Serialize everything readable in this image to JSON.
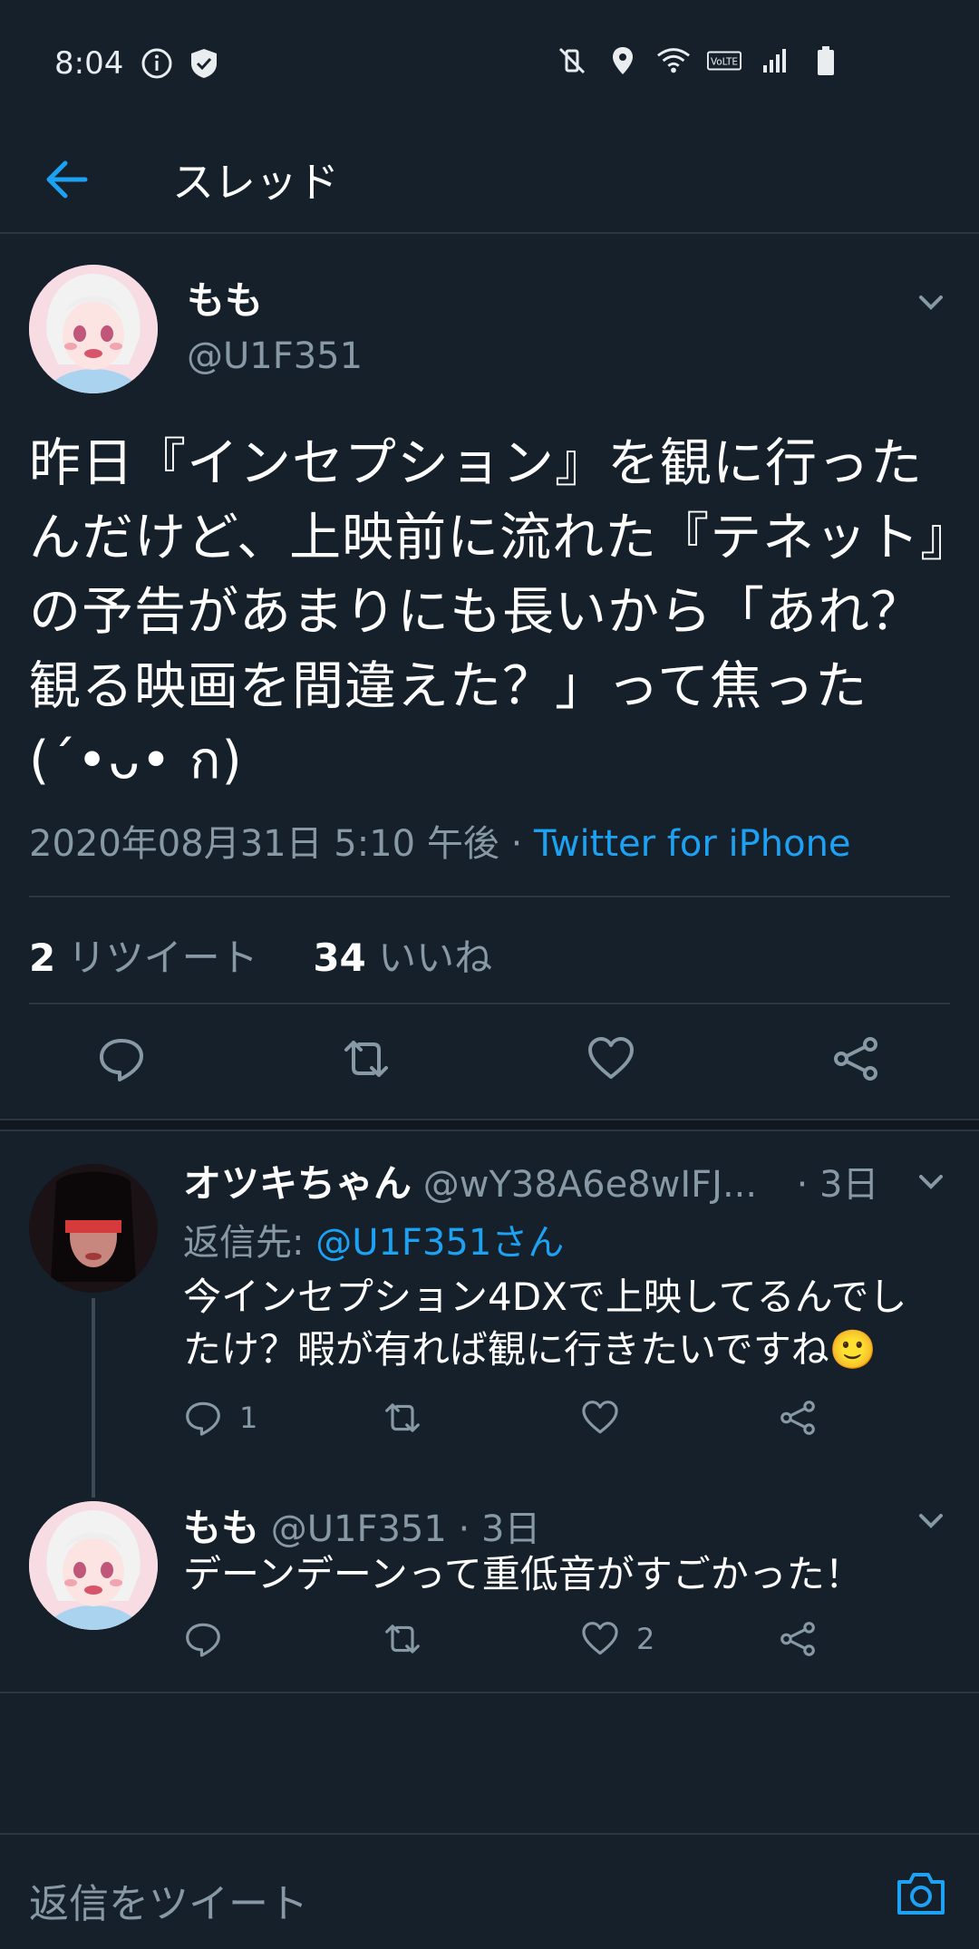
{
  "status_bar": {
    "time": "8:04",
    "icons_left": [
      "info-icon",
      "shield-icon"
    ],
    "icons_right": [
      "mute-vibrate-icon",
      "location-icon",
      "wifi-icon",
      "volte-icon",
      "signal-icon",
      "battery-icon"
    ]
  },
  "header": {
    "title": "スレッド",
    "back_icon": "arrow-left-icon"
  },
  "main_tweet": {
    "name": "もも",
    "handle": "@U1F351",
    "text": "昨日『インセプション』を観に行ったんだけど、上映前に流れた『テネット』の予告があまりにも長いから「あれ？観る映画を間違えた？」って焦った(´•ᴗ• ก)",
    "timestamp": "2020年08月31日 5:10 午後",
    "separator": "·",
    "source": "Twitter for iPhone",
    "retweet_count": "2",
    "retweet_label": "リツイート",
    "like_count": "34",
    "like_label": "いいね"
  },
  "replies": [
    {
      "name": "オツキちゃん",
      "handle": "@wY38A6e8wIFJ...",
      "time": "· 3日",
      "reply_to_label": "返信先:",
      "reply_to_mention": "@U1F351さん",
      "text": "今インセプション4DXで上映してるんでしたけ？暇が有れば観に行きたいですね🙂",
      "reply_count": "1",
      "retweet_count": "",
      "like_count": ""
    },
    {
      "name": "もも",
      "handle": "@U1F351",
      "time": "· 3日",
      "text": "デーンデーンって重低音がすごかった！",
      "reply_count": "",
      "retweet_count": "",
      "like_count": "2"
    }
  ],
  "compose": {
    "placeholder": "返信をツイート"
  },
  "colors": {
    "background": "#15202b",
    "accent": "#1da1f2",
    "secondary_text": "#8899a6",
    "divider": "#2b3640"
  }
}
